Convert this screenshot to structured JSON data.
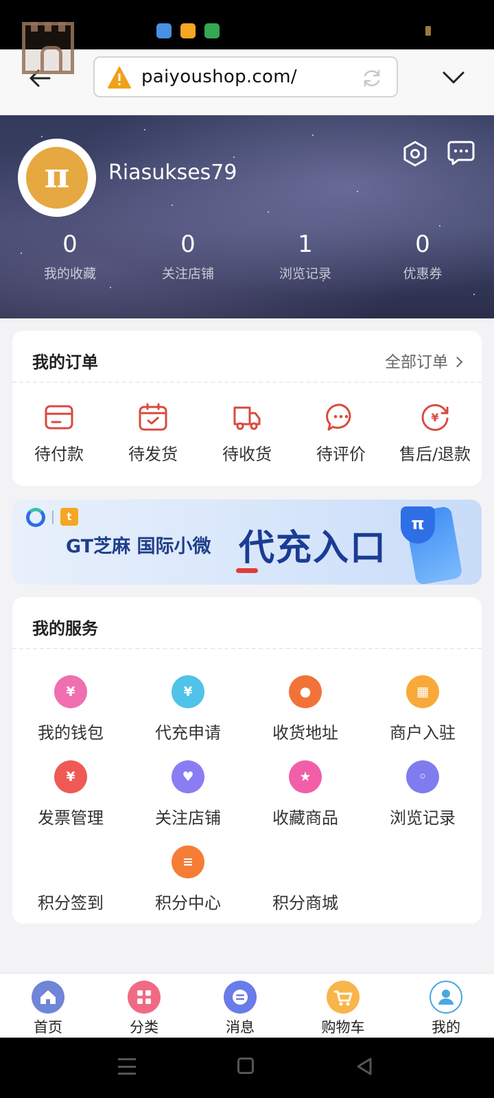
{
  "browser": {
    "url": "paiyoushop.com/"
  },
  "profile": {
    "username": "Riasukses79",
    "avatar_glyph": "π",
    "stats": [
      {
        "value": "0",
        "label": "我的收藏"
      },
      {
        "value": "0",
        "label": "关注店铺"
      },
      {
        "value": "1",
        "label": "浏览记录"
      },
      {
        "value": "0",
        "label": "优惠券"
      }
    ]
  },
  "orders": {
    "title": "我的订单",
    "all_label": "全部订单",
    "items": [
      {
        "label": "待付款",
        "icon": "card-icon"
      },
      {
        "label": "待发货",
        "icon": "calendar-check-icon"
      },
      {
        "label": "待收货",
        "icon": "truck-icon"
      },
      {
        "label": "待评价",
        "icon": "chat-bubble-icon"
      },
      {
        "label": "售后/退款",
        "icon": "refund-icon"
      }
    ],
    "accent_color": "#d94a3d"
  },
  "banner": {
    "subtitle": "GT芝麻 国际小微",
    "headline": "代充入口",
    "logo_glyph": "t",
    "shield_glyph": "π"
  },
  "services": {
    "title": "我的服务",
    "items": [
      {
        "label": "我的钱包",
        "icon": "wallet-icon",
        "glyph": "¥",
        "color": "#f06fb0"
      },
      {
        "label": "代充申请",
        "icon": "recharge-icon",
        "glyph": "¥",
        "color": "#4fc3e8"
      },
      {
        "label": "收货地址",
        "icon": "location-pin-icon",
        "glyph": "●",
        "color": "#f2733a"
      },
      {
        "label": "商户入驻",
        "icon": "store-icon",
        "glyph": "▦",
        "color": "#f8a93a"
      },
      {
        "label": "发票管理",
        "icon": "invoice-icon",
        "glyph": "¥",
        "color": "#ef5a55"
      },
      {
        "label": "关注店铺",
        "icon": "heart-icon",
        "glyph": "♥",
        "color": "#8a7cf3"
      },
      {
        "label": "收藏商品",
        "icon": "star-icon",
        "glyph": "★",
        "color": "#f25fa8"
      },
      {
        "label": "浏览记录",
        "icon": "footprint-icon",
        "glyph": "◦",
        "color": "#7f7cf0"
      },
      {
        "label": "积分签到",
        "icon": "",
        "glyph": "",
        "color": ""
      },
      {
        "label": "积分中心",
        "icon": "coins-icon",
        "glyph": "≡",
        "color": "#f57d35"
      },
      {
        "label": "积分商城",
        "icon": "",
        "glyph": "",
        "color": ""
      }
    ]
  },
  "bottom_nav": [
    {
      "label": "首页",
      "icon": "home-icon",
      "glyph": "⌂",
      "color": "#6f86d6"
    },
    {
      "label": "分类",
      "icon": "grid-icon",
      "glyph": "▦",
      "color": "#f06a85"
    },
    {
      "label": "消息",
      "icon": "message-icon",
      "glyph": "≡",
      "color": "#6a7bea"
    },
    {
      "label": "购物车",
      "icon": "cart-icon",
      "glyph": "🛒",
      "color": "#f8b54a"
    },
    {
      "label": "我的",
      "icon": "user-icon",
      "glyph": "●",
      "color": "#4aa8e0"
    }
  ]
}
